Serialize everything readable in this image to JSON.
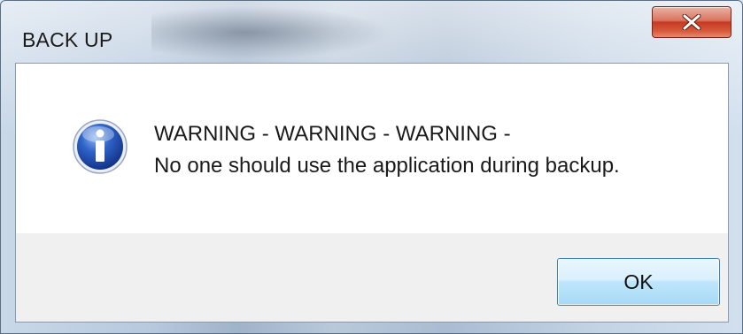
{
  "window": {
    "title": "BACK UP",
    "close_icon": "close-x-icon"
  },
  "dialog": {
    "icon": "information-icon",
    "message_line1": "WARNING - WARNING - WARNING -",
    "message_line2": "No one should use the application during backup.",
    "ok_label": "OK"
  },
  "colors": {
    "close_button": "#c63a22",
    "ok_button_border": "#3c7fb1",
    "info_icon_blue": "#1f4fb0"
  }
}
